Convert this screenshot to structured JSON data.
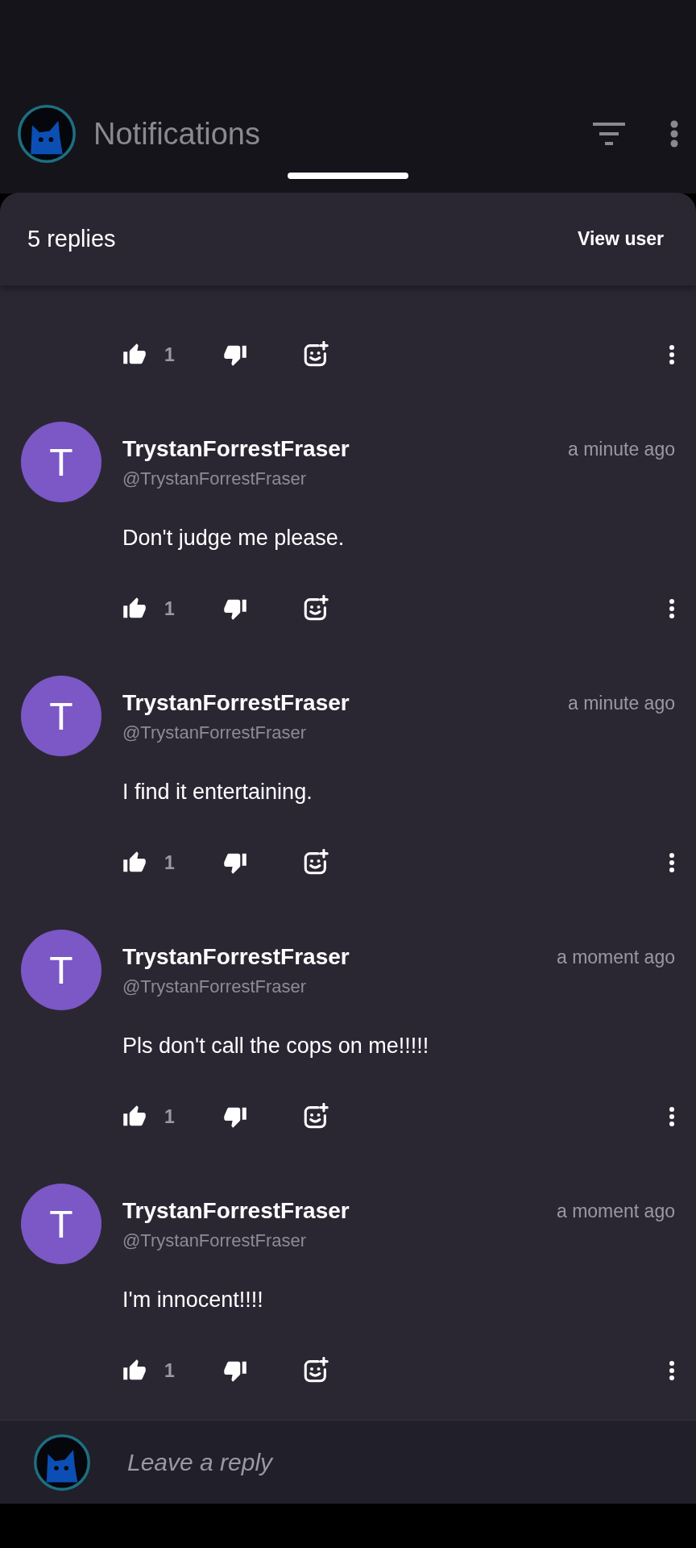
{
  "app_bar": {
    "title": "Notifications"
  },
  "sheet": {
    "title": "5 replies",
    "action": "View user"
  },
  "partial_item": {
    "likes": "1"
  },
  "comments": [
    {
      "initial": "T",
      "name": "TrystanForrestFraser",
      "handle": "@TrystanForrestFraser",
      "time": "a minute ago",
      "text": "Don't judge me please.",
      "likes": "1"
    },
    {
      "initial": "T",
      "name": "TrystanForrestFraser",
      "handle": "@TrystanForrestFraser",
      "time": "a minute ago",
      "text": "I find it entertaining.",
      "likes": "1"
    },
    {
      "initial": "T",
      "name": "TrystanForrestFraser",
      "handle": "@TrystanForrestFraser",
      "time": "a moment ago",
      "text": "Pls don't call the cops on me!!!!!",
      "likes": "1"
    },
    {
      "initial": "T",
      "name": "TrystanForrestFraser",
      "handle": "@TrystanForrestFraser",
      "time": "a moment ago",
      "text": "I'm innocent!!!!",
      "likes": "1"
    }
  ],
  "reply_bar": {
    "placeholder": "Leave a reply"
  }
}
